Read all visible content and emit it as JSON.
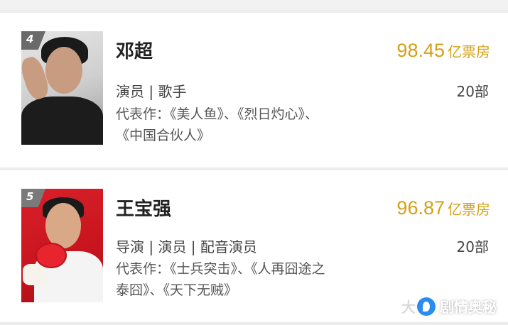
{
  "entries": [
    {
      "rank": "4",
      "name": "邓超",
      "box_office_value": "98.45",
      "box_office_unit": "亿票房",
      "roles": "演员 | 歌手",
      "film_count": "20部",
      "works_prefix": "代表作：",
      "works_line1": "代表作：《美人鱼》、《烈日灼心》、",
      "works_line2": "《中国合伙人》"
    },
    {
      "rank": "5",
      "name": "王宝强",
      "box_office_value": "96.87",
      "box_office_unit": "亿票房",
      "roles": "导演 | 演员 | 配音演员",
      "film_count": "20部",
      "works_line1": "代表作：《士兵突击》、《人再囧途之",
      "works_line2": "泰囧》、《天下无贼》"
    }
  ],
  "watermark": {
    "ghost_text": "大",
    "brand_text": "剧情奥秘"
  },
  "colors": {
    "accent_gold": "#d4a017",
    "background": "#f2f2f2"
  }
}
